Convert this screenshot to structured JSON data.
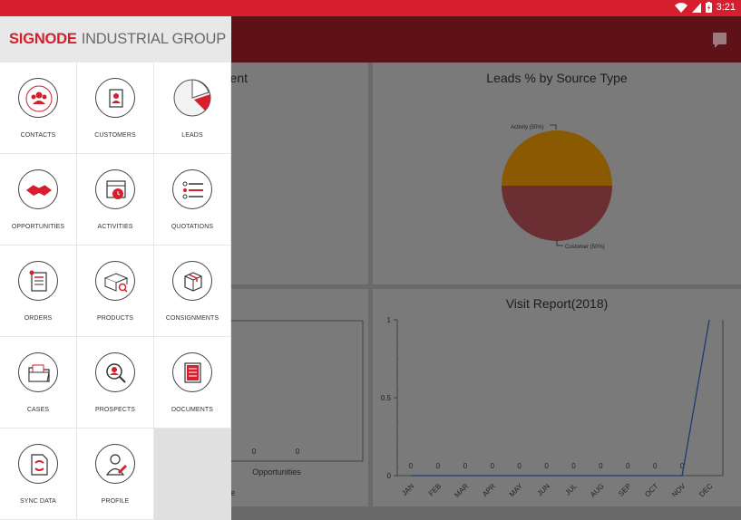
{
  "status": {
    "time": "3:21"
  },
  "brand": {
    "part1": "SIGNODE",
    "part2": "INDUSTRIAL GROUP"
  },
  "menu": [
    {
      "label": "CONTACTS",
      "icon": "contacts-icon"
    },
    {
      "label": "CUSTOMERS",
      "icon": "customers-icon"
    },
    {
      "label": "LEADS",
      "icon": "leads-icon"
    },
    {
      "label": "OPPORTUNITIES",
      "icon": "opportunities-icon"
    },
    {
      "label": "ACTIVITIES",
      "icon": "activities-icon"
    },
    {
      "label": "QUOTATIONS",
      "icon": "quotations-icon"
    },
    {
      "label": "ORDERS",
      "icon": "orders-icon"
    },
    {
      "label": "PRODUCTS",
      "icon": "products-icon"
    },
    {
      "label": "CONSIGNMENTS",
      "icon": "consignments-icon"
    },
    {
      "label": "CASES",
      "icon": "cases-icon"
    },
    {
      "label": "PROSPECTS",
      "icon": "prospects-icon"
    },
    {
      "label": "DOCUMENTS",
      "icon": "documents-icon"
    },
    {
      "label": "SYNC DATA",
      "icon": "sync-data-icon"
    },
    {
      "label": "PROFILE",
      "icon": "profile-icon"
    }
  ],
  "cards": {
    "top_left_title_fragment": "ent",
    "leads_title": "Leads % by Source Type",
    "visit_title": "Visit Report(2018)",
    "opps_label": "Opportunities",
    "opps_values": [
      "0",
      "0"
    ],
    "bottom_left_fragment": "e"
  },
  "colors": {
    "accent": "#d51f2f",
    "appbar": "#5e1117"
  },
  "chart_data": [
    {
      "type": "pie",
      "title": "Leads % by Source Type",
      "categories": [
        "Activity",
        "Customer"
      ],
      "values": [
        50,
        50
      ],
      "labels": [
        "Activity (50%)",
        "Customer (50%)"
      ],
      "colors": [
        "#8a5a00",
        "#6b2f33"
      ]
    },
    {
      "type": "line",
      "title": "Visit Report(2018)",
      "categories": [
        "JAN",
        "FEB",
        "MAR",
        "APR",
        "MAY",
        "JUN",
        "JUL",
        "AUG",
        "SEP",
        "OCT",
        "NOV",
        "DEC"
      ],
      "values": [
        0,
        0,
        0,
        0,
        0,
        0,
        0,
        0,
        0,
        0,
        0,
        1
      ],
      "value_labels": [
        "0",
        "0",
        "0",
        "0",
        "0",
        "0",
        "0",
        "0",
        "0",
        "0",
        "0",
        ""
      ],
      "ylim": [
        0,
        1
      ],
      "yticks": [
        "0",
        "0.5",
        "1"
      ]
    }
  ]
}
